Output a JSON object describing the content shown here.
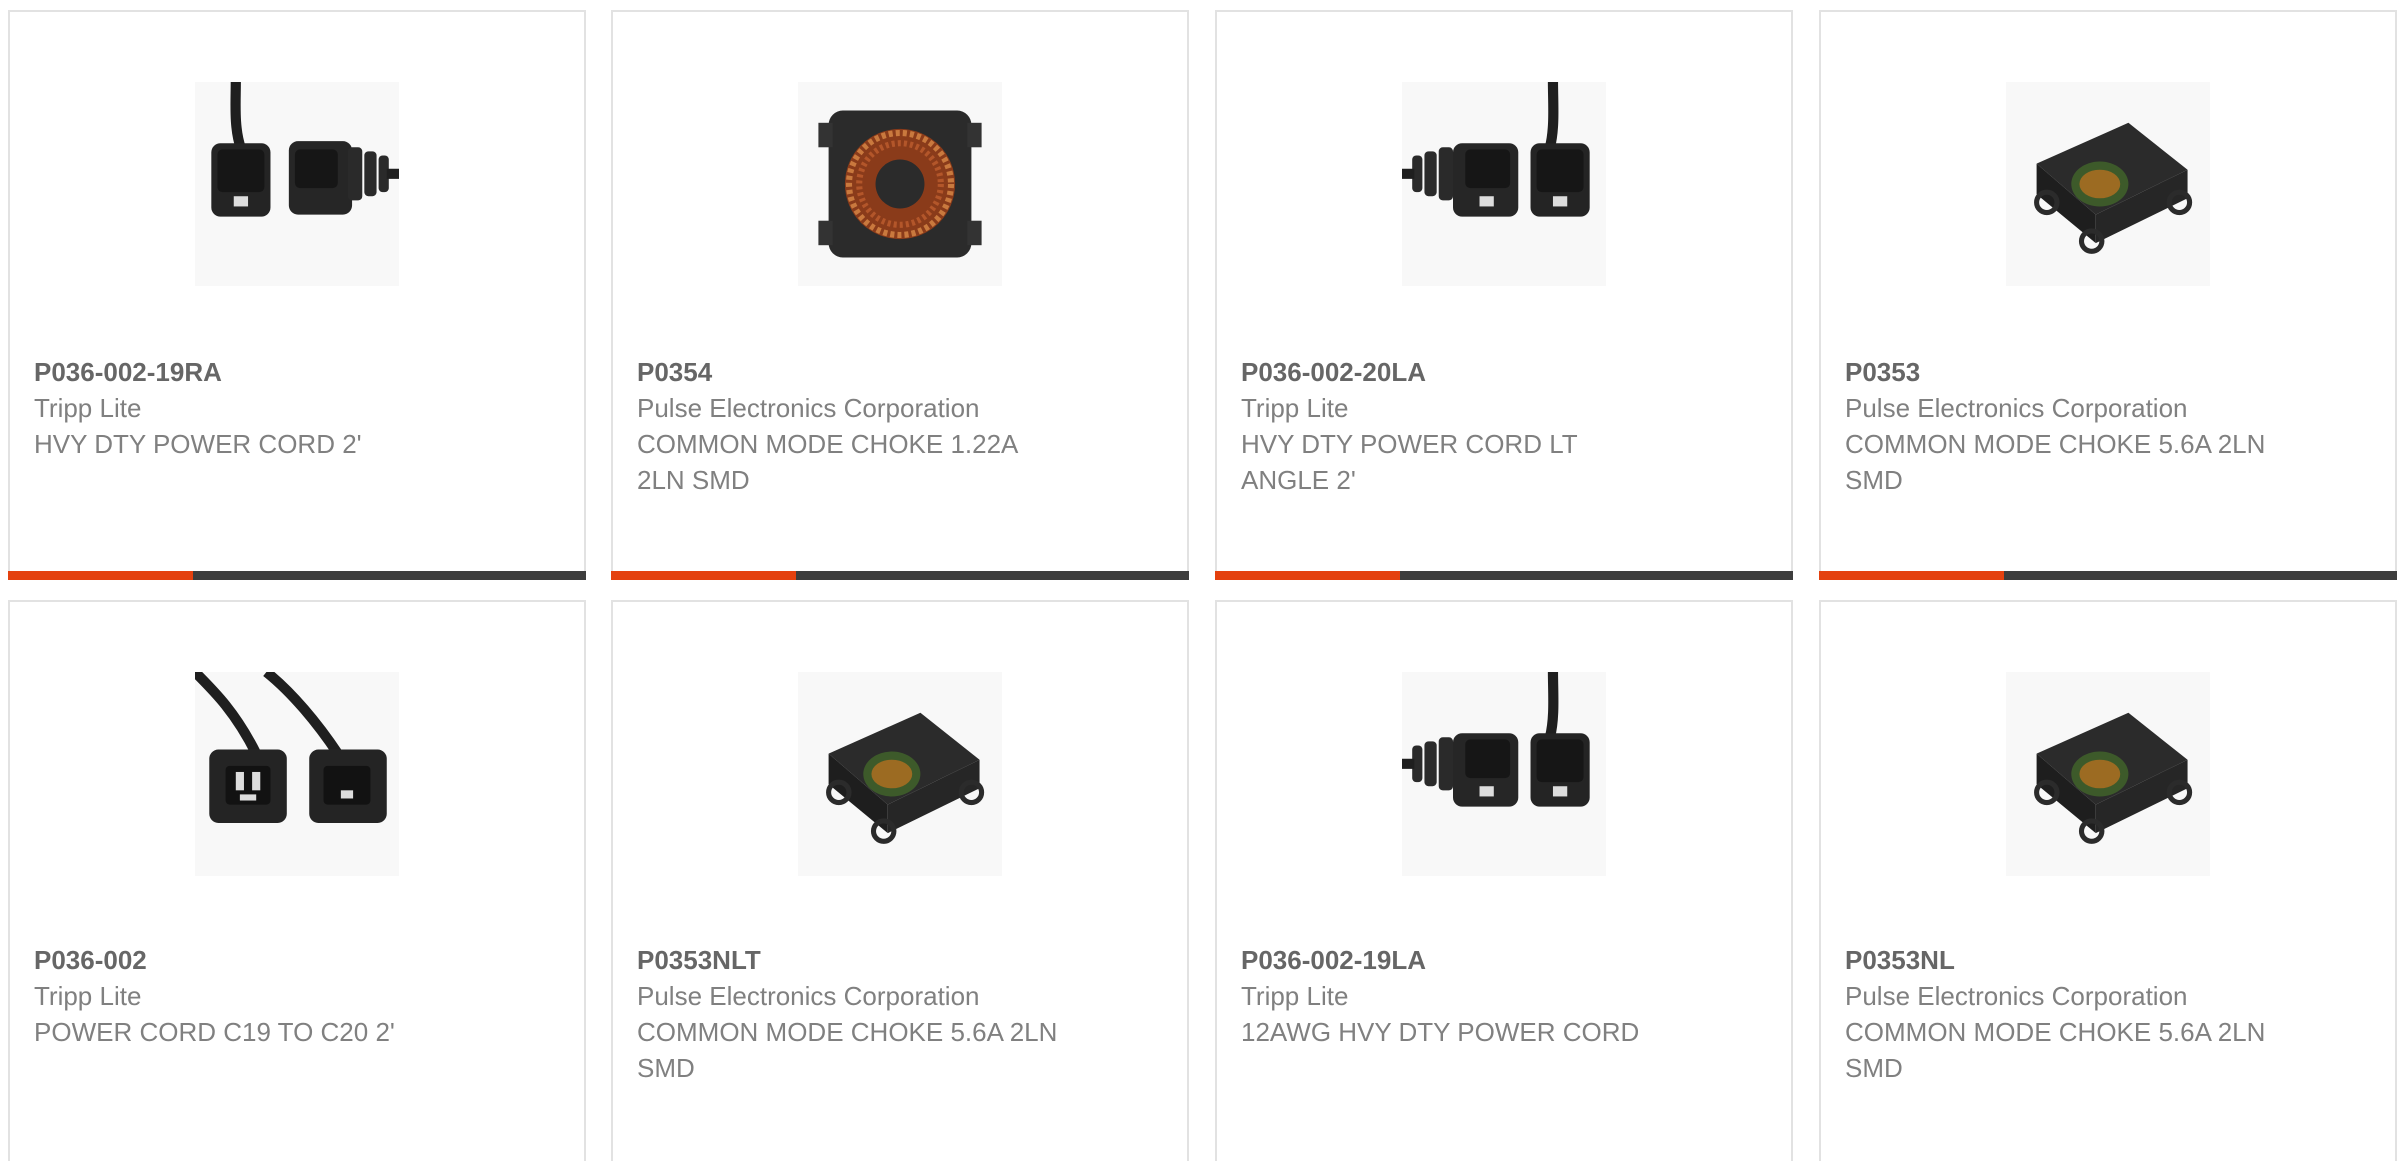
{
  "colors": {
    "accent": "#e4410f",
    "bar_track": "#3d3d3d",
    "card_border": "#e2e2e2",
    "text": "#808080"
  },
  "products": [
    {
      "part": "P036-002-19RA",
      "maker": "Tripp Lite",
      "desc": "HVY DTY POWER CORD 2'",
      "image": "power-cord-right-angle-icon",
      "progress": 0.32
    },
    {
      "part": "P0354",
      "maker": "Pulse Electronics Corporation",
      "desc": "COMMON MODE CHOKE 1.22A 2LN SMD",
      "image": "toroid-choke-icon",
      "progress": 0.32
    },
    {
      "part": "P036-002-20LA",
      "maker": "Tripp Lite",
      "desc": "HVY DTY POWER CORD LT ANGLE 2'",
      "image": "power-cord-left-angle-icon",
      "progress": 0.32
    },
    {
      "part": "P0353",
      "maker": "Pulse Electronics Corporation",
      "desc": "COMMON MODE CHOKE 5.6A 2LN SMD",
      "image": "smd-choke-icon",
      "progress": 0.32
    },
    {
      "part": "P036-002",
      "maker": "Tripp Lite",
      "desc": "POWER CORD C19 TO C20 2'",
      "image": "power-cord-straight-icon"
    },
    {
      "part": "P0353NLT",
      "maker": "Pulse Electronics Corporation",
      "desc": "COMMON MODE CHOKE 5.6A 2LN SMD",
      "image": "smd-choke-icon"
    },
    {
      "part": "P036-002-19LA",
      "maker": "Tripp Lite",
      "desc": "12AWG HVY DTY POWER CORD",
      "image": "power-cord-left-angle-icon"
    },
    {
      "part": "P0353NL",
      "maker": "Pulse Electronics Corporation",
      "desc": "COMMON MODE CHOKE 5.6A 2LN SMD",
      "image": "smd-choke-icon"
    }
  ]
}
